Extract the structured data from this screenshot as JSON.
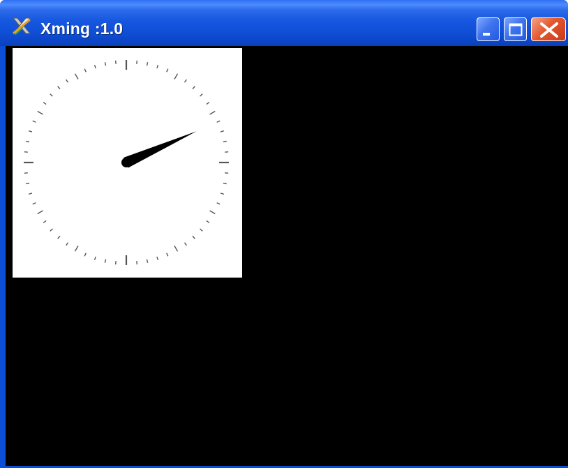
{
  "window": {
    "title": "Xming :1.0",
    "app_icon": "xming-x-icon",
    "controls": [
      "minimize-icon",
      "maximize-icon",
      "close-icon"
    ],
    "title_bar_color": "#0a4fd6",
    "close_button_color": "#e4582f",
    "desktop_color": "#000000"
  },
  "clock": {
    "type": "analog",
    "face_color": "#ffffff",
    "hand_color": "#000000",
    "tick_color": "#555555",
    "hour": 2,
    "minute": 11
  }
}
